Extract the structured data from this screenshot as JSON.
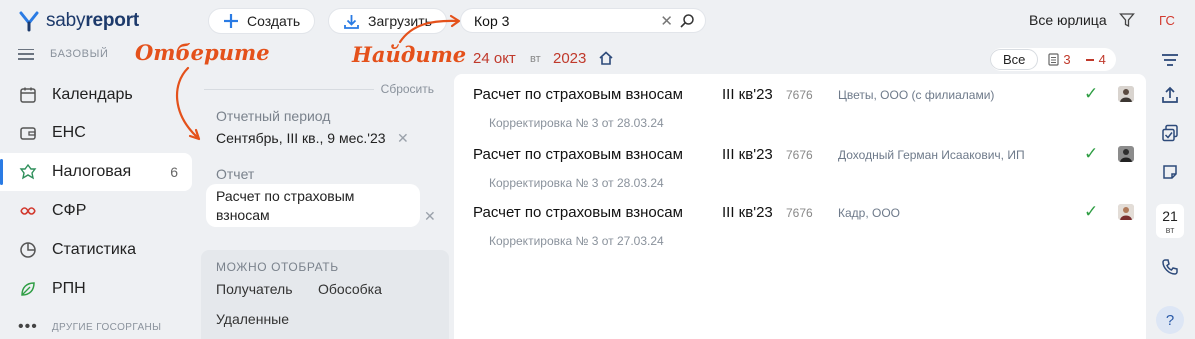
{
  "app": {
    "logo_regular": "saby",
    "logo_bold": "report",
    "plan": "БАЗОВЫЙ"
  },
  "nav": {
    "items": [
      {
        "label": "Календарь",
        "icon": "calendar-icon"
      },
      {
        "label": "ЕНС",
        "icon": "wallet-icon"
      },
      {
        "label": "Налоговая",
        "icon": "tax-emblem-icon",
        "count": "6",
        "active": true
      },
      {
        "label": "СФР",
        "icon": "sfr-icon"
      },
      {
        "label": "Статистика",
        "icon": "pie-chart-icon"
      },
      {
        "label": "РПН",
        "icon": "leaf-icon"
      }
    ],
    "more_label": "ДРУГИЕ ГОСОРГАНЫ"
  },
  "toolbar": {
    "create_label": "Создать",
    "upload_label": "Загрузить",
    "search_value": "Кор 3",
    "legal_entities": "Все юрлица",
    "user_initials_first": "Г",
    "user_initials_second": "С"
  },
  "annotations": {
    "select": "Отберите",
    "find": "Найдите"
  },
  "filter": {
    "reset_label": "Сбросить",
    "period_label": "Отчетный период",
    "period_value": "Сентябрь, III кв., 9 мес.'23",
    "report_label": "Отчет",
    "report_value": "Расчет по страховым взносам",
    "can_select_title": "МОЖНО ОТОБРАТЬ",
    "options": [
      "Получатель",
      "Обособка",
      "Удаленные"
    ]
  },
  "dateline": {
    "day": "24 окт",
    "weekday": "вт",
    "year": "2023"
  },
  "segments": {
    "all": "Все",
    "docs_count": "3",
    "errors_count": "4"
  },
  "rows": [
    {
      "name": "Расчет по страховым взносам",
      "period": "III кв'23",
      "code": "7676",
      "org": "Цветы, ООО (с филиалами)",
      "sub": "Корректировка № 3 от 28.03.24"
    },
    {
      "name": "Расчет по страховым взносам",
      "period": "III кв'23",
      "code": "7676",
      "org": "Доходный Герман Исаакович, ИП",
      "sub": "Корректировка № 3 от 28.03.24"
    },
    {
      "name": "Расчет по страховым взносам",
      "period": "III кв'23",
      "code": "7676",
      "org": "Кадр, ООО",
      "sub": "Корректировка № 3 от 27.03.24"
    }
  ],
  "rail": {
    "cal_day": "21",
    "cal_weekday": "вт",
    "help": "?"
  },
  "colors": {
    "accent": "#2a7be4",
    "annotation": "#e4511b",
    "date_red": "#c0392b",
    "check_green": "#2f9e44"
  }
}
